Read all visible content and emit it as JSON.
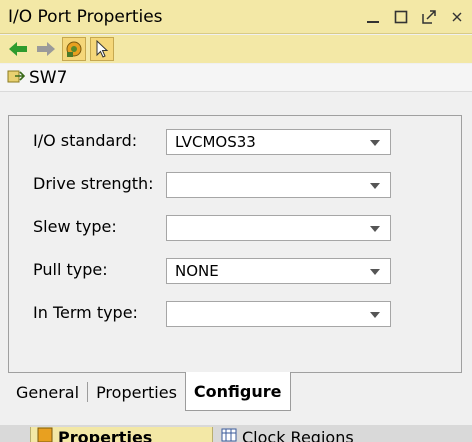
{
  "window": {
    "title": "I/O Port Properties",
    "controls": [
      "minimize-icon",
      "maximize-icon",
      "float-icon",
      "close-icon"
    ]
  },
  "toolbar": {
    "buttons": [
      "back-arrow-icon",
      "forward-arrow-icon",
      "auto-update-icon",
      "select-cursor-icon"
    ]
  },
  "object": {
    "name": "SW7",
    "icon": "port-icon"
  },
  "form": {
    "rows": [
      {
        "label": "I/O standard:",
        "value": "LVCMOS33"
      },
      {
        "label": "Drive strength:",
        "value": ""
      },
      {
        "label": "Slew type:",
        "value": ""
      },
      {
        "label": "Pull type:",
        "value": "NONE"
      },
      {
        "label": "In Term type:",
        "value": ""
      }
    ]
  },
  "tabs": [
    {
      "label": "General",
      "active": false
    },
    {
      "label": "Properties",
      "active": false
    },
    {
      "label": "Configure",
      "active": true
    }
  ],
  "bottom_tabs": [
    {
      "label": "Properties",
      "icon": "properties-icon",
      "active": true
    },
    {
      "label": "Clock Regions",
      "icon": "clock-regions-icon",
      "active": false
    }
  ],
  "colors": {
    "title_bg": "#f3e8a6",
    "panel_bg": "#f0f0f0",
    "forward_green": "#2e9b2e"
  }
}
